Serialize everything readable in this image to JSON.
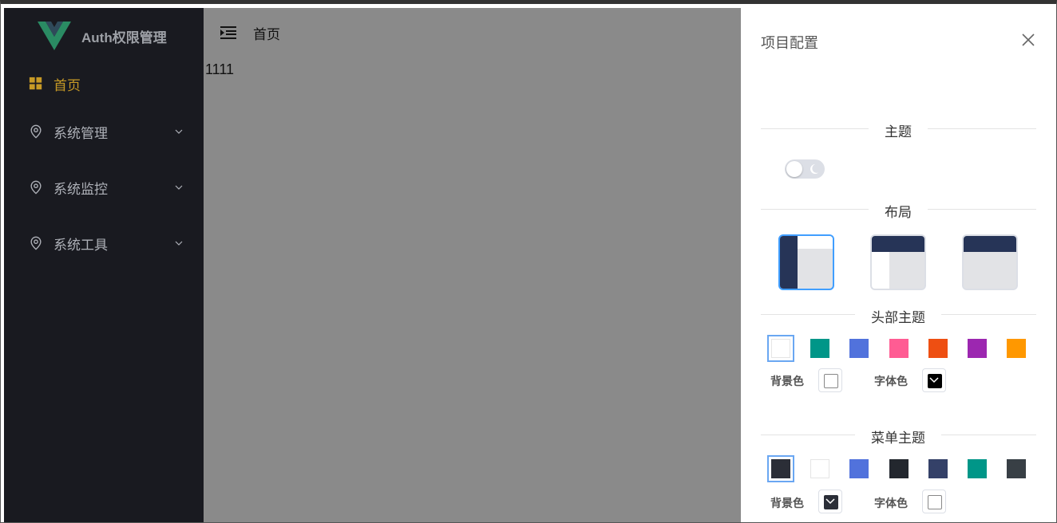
{
  "app": {
    "title": "Auth权限管理"
  },
  "sidebar": {
    "items": [
      {
        "label": "首页",
        "icon": "grid-icon",
        "active": true
      },
      {
        "label": "系统管理",
        "icon": "location-pin-icon"
      },
      {
        "label": "系统监控",
        "icon": "location-pin-icon"
      },
      {
        "label": "系统工具",
        "icon": "location-pin-icon"
      }
    ]
  },
  "topbar": {
    "breadcrumb": "首页"
  },
  "content": {
    "text": "1111"
  },
  "drawer": {
    "title": "项目配置",
    "sections": {
      "theme": "主题",
      "layout": "布局",
      "header_theme": "头部主题",
      "menu_theme": "菜单主题"
    },
    "header_colors": [
      "#ffffff",
      "#009688",
      "#5172dc",
      "#ff5c93",
      "#ee4f12",
      "#9c27b0",
      "#ff9800"
    ],
    "menu_colors": [
      "#2b2e37",
      "#ffffff",
      "#5172dc",
      "#23272e",
      "#344168",
      "#009688",
      "#383f45"
    ],
    "header_bg_label": "背景色",
    "header_font_label": "字体色",
    "menu_bg_label": "背景色",
    "menu_font_label": "字体色",
    "accent_color": "#c79a26",
    "selected_color": "#409eff"
  }
}
